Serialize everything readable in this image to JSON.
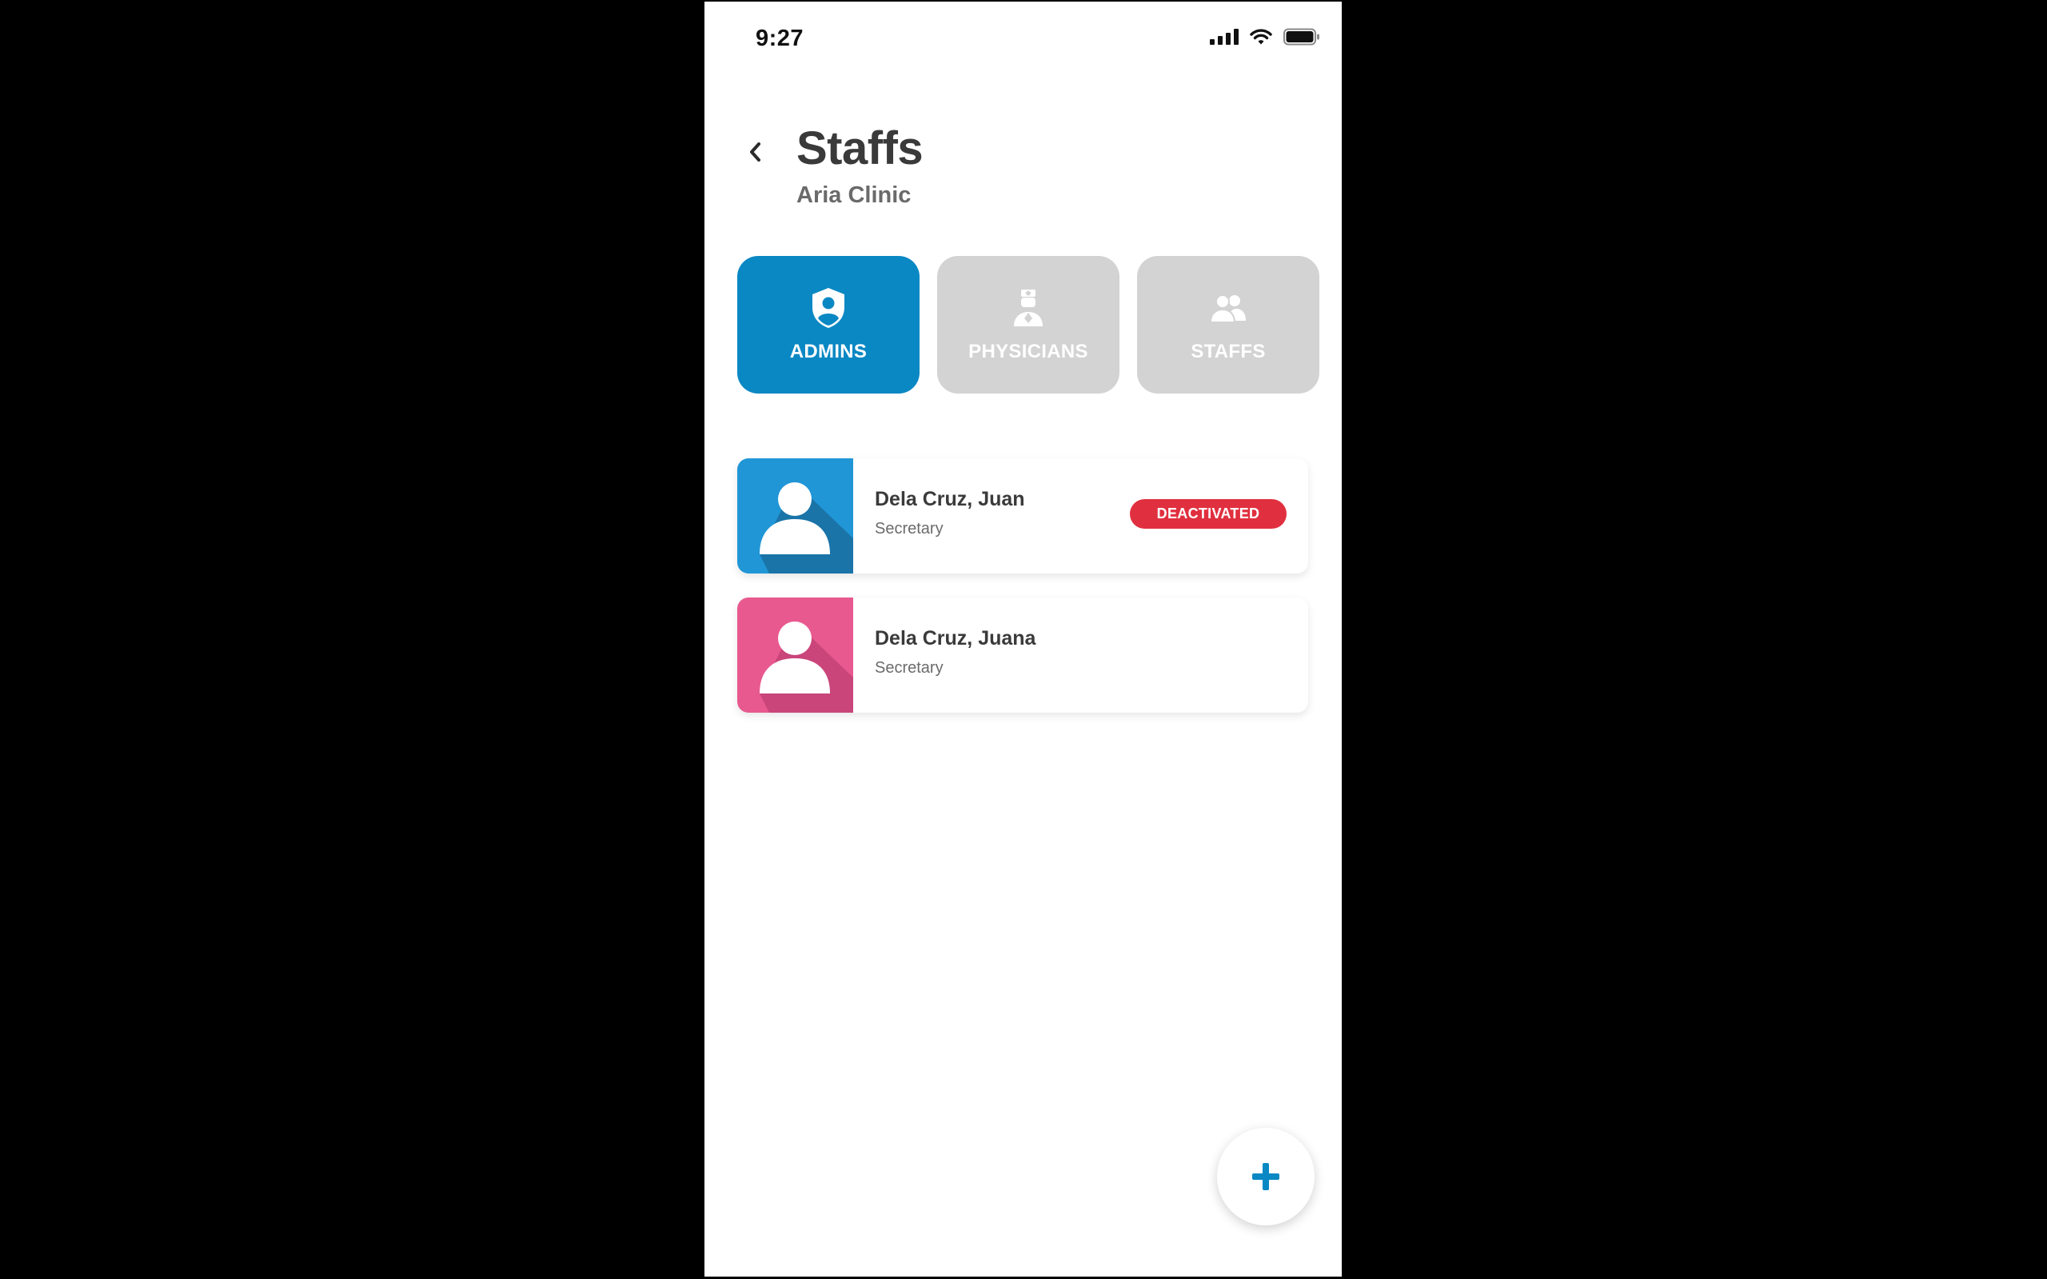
{
  "status_bar": {
    "time": "9:27",
    "icons": [
      "signal-icon",
      "wifi-icon",
      "battery-icon"
    ]
  },
  "header": {
    "back_icon": "chevron-left-icon",
    "title": "Staffs",
    "subtitle": "Aria Clinic"
  },
  "role_tabs": [
    {
      "label": "ADMINS",
      "icon": "shield-user-icon",
      "active": true
    },
    {
      "label": "PHYSICIANS",
      "icon": "doctor-icon",
      "active": false
    },
    {
      "label": "STAFFS",
      "icon": "users-icon",
      "active": false
    }
  ],
  "staff": [
    {
      "name": "Dela Cruz, Juan",
      "role": "Secretary",
      "status": "DEACTIVATED",
      "avatar_color": "#2196d6"
    },
    {
      "name": "Dela Cruz, Juana",
      "role": "Secretary",
      "status": "",
      "avatar_color": "#e8598f"
    }
  ],
  "fab": {
    "icon": "plus-icon"
  },
  "colors": {
    "accent": "#0a88c4",
    "inactive_tab": "#d3d3d3",
    "deactivated_badge": "#e0303f"
  }
}
